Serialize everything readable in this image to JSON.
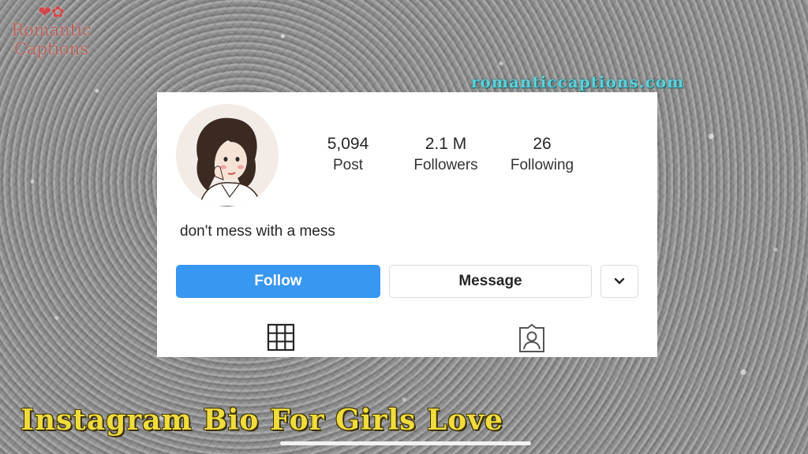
{
  "brand": {
    "line1": "Romantic",
    "line2": "Captions"
  },
  "site_url": "romanticcaptions.com",
  "profile": {
    "stats": [
      {
        "value": "5,094",
        "label": "Post"
      },
      {
        "value": "2.1 M",
        "label": "Followers"
      },
      {
        "value": "26",
        "label": "Following"
      }
    ],
    "bio": "don't mess with a mess",
    "buttons": {
      "follow": "Follow",
      "message": "Message"
    }
  },
  "caption": "Instagram Bio For Girls Love",
  "colors": {
    "follow_blue": "#3897f0",
    "caption_yellow": "#f0dc3c",
    "url_cyan": "#5fd0d8",
    "brand_red": "#b5605a"
  },
  "icons": [
    "heart-rose-icon",
    "grid-icon",
    "tagged-person-icon",
    "chevron-down-icon"
  ]
}
